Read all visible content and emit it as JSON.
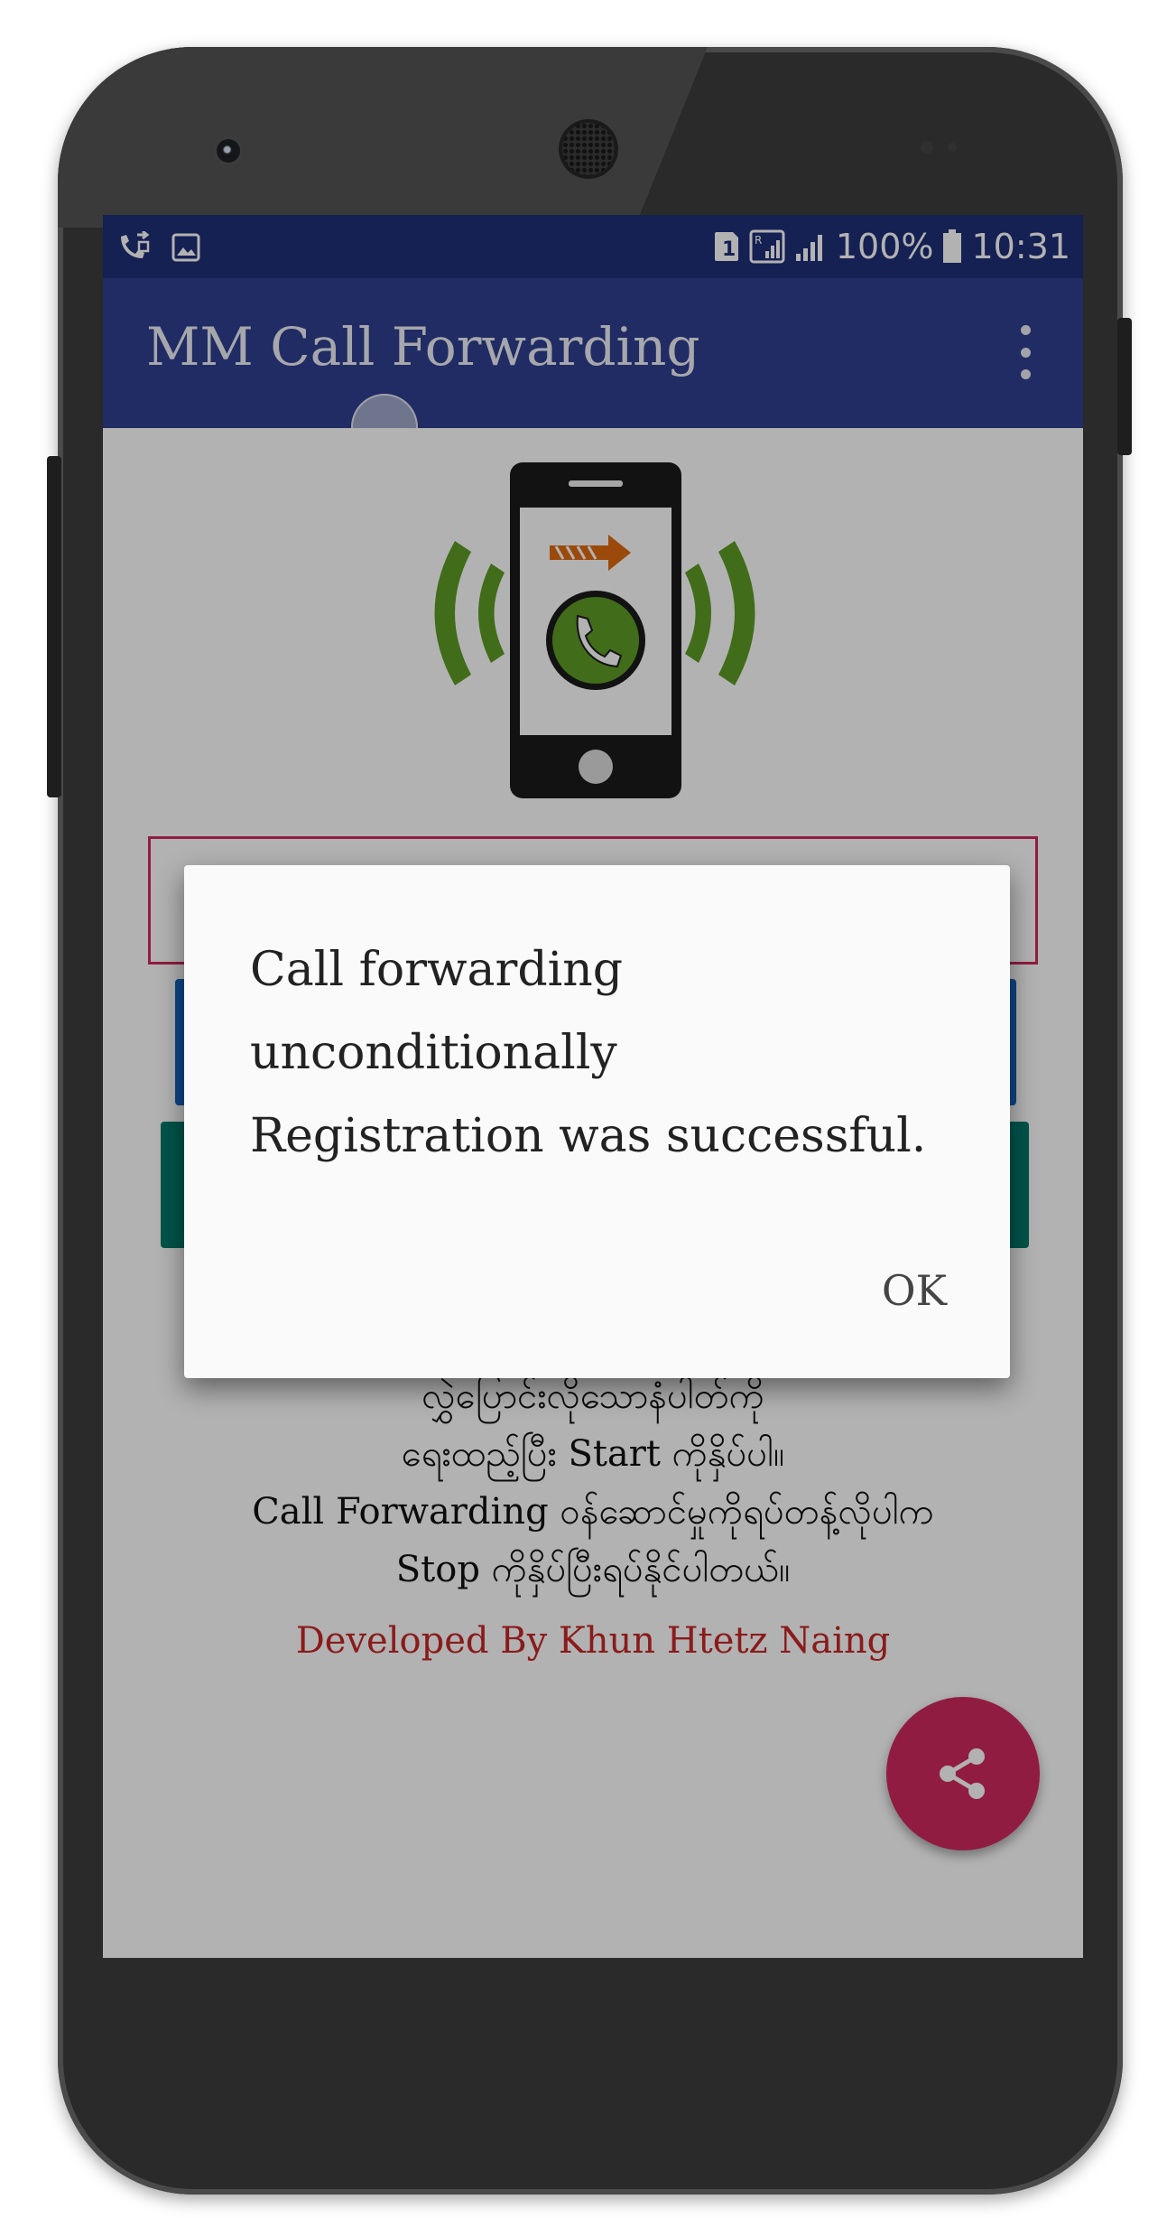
{
  "status_bar": {
    "left_icons": [
      "call-forward-icon",
      "image-icon"
    ],
    "sim_badge": "1",
    "signal_icons": [
      "sim-signal-icon",
      "cell-signal-icon"
    ],
    "battery": "100%",
    "time": "10:31"
  },
  "app_bar": {
    "title": "MM Call Forwarding",
    "menu_icon": "overflow-menu-icon"
  },
  "logo": {
    "icon": "phone-forwarding-icon",
    "colors": {
      "phone": "#1a1a1a",
      "arrow": "#e06a10",
      "waves": "#5e9b25"
    }
  },
  "background_text": {
    "line1": "လွှဲပြောင်းလိုသောနံပါတ်ကို",
    "line2": "ရေးထည့်ပြီး Start ကိုနှိပ်ပါ။",
    "line3": "Call Forwarding ဝန်ဆောင်မှုကိုရပ်တန့်လိုပါက",
    "line4": "Stop ကိုနှိပ်ပြီးရပ်နိုင်ပါတယ်။",
    "developer": "Developed By Khun Htetz Naing"
  },
  "fab": {
    "icon": "share-icon",
    "color": "#d0295f"
  },
  "dialog": {
    "line1": "Call forwarding",
    "line2": "unconditionally",
    "line3": "Registration was successful.",
    "ok_label": "OK"
  },
  "colors": {
    "status_bar": "#1f2e77",
    "app_bar": "#2f3f8f",
    "accent": "#d0295f",
    "start_button": "#1565c0",
    "stop_button": "#00796b",
    "developer_text": "#c62828"
  }
}
